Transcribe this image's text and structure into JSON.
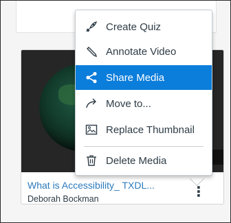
{
  "menu": {
    "items": [
      {
        "label": "Create Quiz",
        "icon": "quiz-rocket-icon"
      },
      {
        "label": "Annotate Video",
        "icon": "pencil-icon"
      },
      {
        "label": "Share Media",
        "icon": "share-icon",
        "active": true
      },
      {
        "label": "Move to...",
        "icon": "move-arrow-icon"
      },
      {
        "label": "Replace Thumbnail",
        "icon": "image-icon"
      },
      {
        "label": "Delete Media",
        "icon": "trash-icon"
      }
    ],
    "active_color": "#0b7ddb"
  },
  "card": {
    "title": "What is Accessibility_ TXDL...",
    "author": "Deborah Bockman",
    "kebab": "⋮"
  }
}
